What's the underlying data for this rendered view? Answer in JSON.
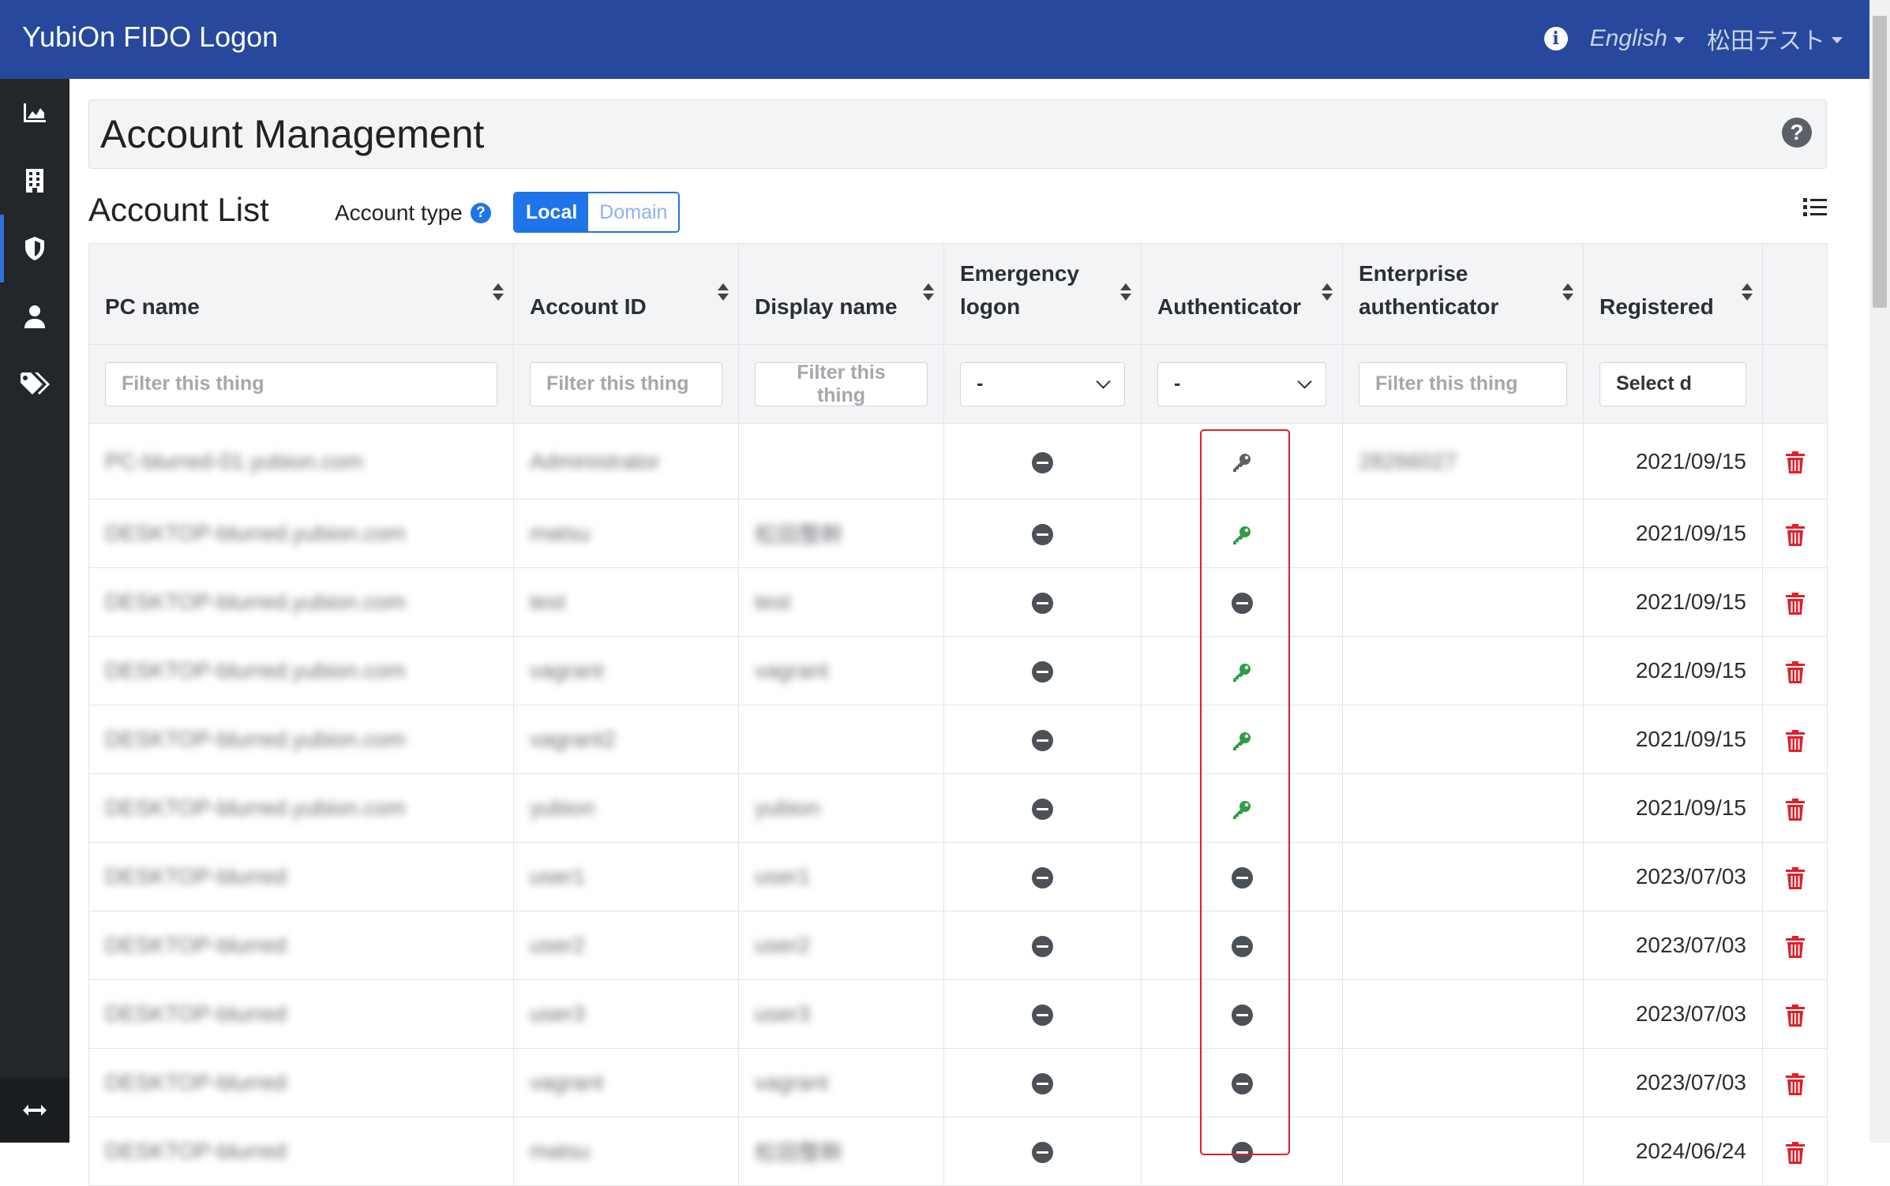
{
  "app": {
    "title": "YubiOn FIDO Logon"
  },
  "topbar": {
    "language": "English",
    "user": "松田テスト"
  },
  "sidebar": {
    "items": [
      "chart-icon",
      "building-icon",
      "shield-icon",
      "user-icon",
      "tags-icon"
    ],
    "bottom": "expand-arrows-icon",
    "active_index": 2
  },
  "page": {
    "title": "Account Management"
  },
  "list": {
    "title": "Account List",
    "account_type_label": "Account type",
    "type_options": [
      "Local",
      "Domain"
    ],
    "selected_type": "Local"
  },
  "table": {
    "headers": {
      "pc": "PC name",
      "account": "Account ID",
      "display": "Display name",
      "emergency": "Emergency logon",
      "auth": "Authenticator",
      "enterprise": "Enterprise authenticator",
      "registered": "Registered"
    },
    "filters": {
      "pc": "Filter this thing",
      "account": "Filter this thing",
      "display": "Filter this thing",
      "emergency": "-",
      "auth": "-",
      "enterprise": "Filter this thing",
      "registered": "Select d"
    },
    "rows": [
      {
        "pc": "PC-blurred-01.yubion.com",
        "account": "Administrator",
        "display": "",
        "emergency": "none",
        "auth": "key-gray",
        "enterprise": "28266027",
        "registered": "2021/09/15"
      },
      {
        "pc": "DESKTOP-blurred.yubion.com",
        "account": "matsu",
        "display": "松田整幹",
        "emergency": "none",
        "auth": "key-green",
        "enterprise": "",
        "registered": "2021/09/15"
      },
      {
        "pc": "DESKTOP-blurred.yubion.com",
        "account": "test",
        "display": "test",
        "emergency": "none",
        "auth": "none",
        "enterprise": "",
        "registered": "2021/09/15"
      },
      {
        "pc": "DESKTOP-blurred.yubion.com",
        "account": "vagrant",
        "display": "vagrant",
        "emergency": "none",
        "auth": "key-green",
        "enterprise": "",
        "registered": "2021/09/15"
      },
      {
        "pc": "DESKTOP-blurred.yubion.com",
        "account": "vagrant2",
        "display": "",
        "emergency": "none",
        "auth": "key-green",
        "enterprise": "",
        "registered": "2021/09/15"
      },
      {
        "pc": "DESKTOP-blurred.yubion.com",
        "account": "yubion",
        "display": "yubion",
        "emergency": "none",
        "auth": "key-green",
        "enterprise": "",
        "registered": "2021/09/15"
      },
      {
        "pc": "DESKTOP-blurred",
        "account": "user1",
        "display": "user1",
        "emergency": "none",
        "auth": "none",
        "enterprise": "",
        "registered": "2023/07/03"
      },
      {
        "pc": "DESKTOP-blurred",
        "account": "user2",
        "display": "user2",
        "emergency": "none",
        "auth": "none",
        "enterprise": "",
        "registered": "2023/07/03"
      },
      {
        "pc": "DESKTOP-blurred",
        "account": "user3",
        "display": "user3",
        "emergency": "none",
        "auth": "none",
        "enterprise": "",
        "registered": "2023/07/03"
      },
      {
        "pc": "DESKTOP-blurred",
        "account": "vagrant",
        "display": "vagrant",
        "emergency": "none",
        "auth": "none",
        "enterprise": "",
        "registered": "2023/07/03"
      },
      {
        "pc": "DESKTOP-blurred",
        "account": "matsu",
        "display": "松田整幹",
        "emergency": "none",
        "auth": "none",
        "enterprise": "",
        "registered": "2024/06/24"
      }
    ]
  },
  "colors": {
    "topbar": "#27489c",
    "sidebar": "#23272b",
    "accent": "#1e74e8",
    "key_green": "#2e9e44",
    "trash_red": "#e0202a",
    "highlight_box": "#e0202a"
  }
}
